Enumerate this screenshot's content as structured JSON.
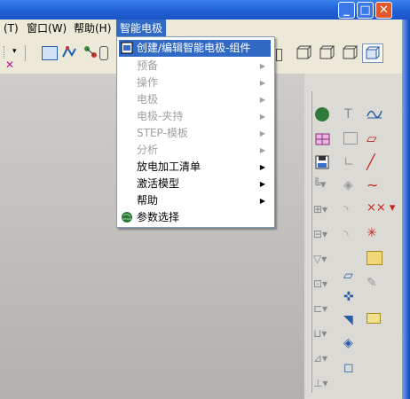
{
  "menubar": {
    "items": [
      "(T)",
      "窗口(W)",
      "帮助(H)",
      "智能电极"
    ]
  },
  "dropdown": {
    "items": [
      {
        "label": "创建/编辑智能电极-组件",
        "enabled": true,
        "submenu": false,
        "icon": "electrode-edit-icon"
      },
      {
        "label": "预备",
        "enabled": false,
        "submenu": true
      },
      {
        "label": "操作",
        "enabled": false,
        "submenu": true
      },
      {
        "label": "电极",
        "enabled": false,
        "submenu": true
      },
      {
        "label": "电极-夹持",
        "enabled": false,
        "submenu": true
      },
      {
        "label": "STEP-模板",
        "enabled": false,
        "submenu": true
      },
      {
        "label": "分析",
        "enabled": false,
        "submenu": true
      },
      {
        "label": "放电加工清单",
        "enabled": true,
        "submenu": true
      },
      {
        "label": "激活模型",
        "enabled": true,
        "submenu": true
      },
      {
        "label": "帮助",
        "enabled": true,
        "submenu": true
      },
      {
        "label": "参数选择",
        "enabled": true,
        "submenu": false,
        "icon": "globe-settings-icon"
      }
    ]
  },
  "window": {
    "min_glyph": "_",
    "max_glyph": "□",
    "close_glyph": "✕"
  },
  "colors": {
    "highlight": "#316ac5",
    "titlebar": "#1f5fd6",
    "menubar": "#ece9d8",
    "workspace": "#c4c2bf"
  }
}
